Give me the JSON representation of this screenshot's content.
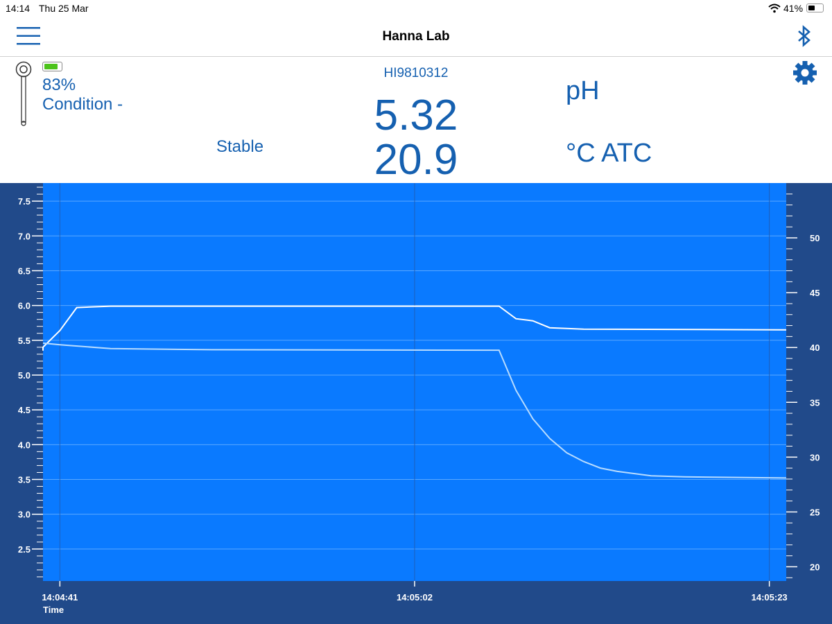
{
  "status_bar": {
    "time": "14:14",
    "date": "Thu 25 Mar",
    "battery": "41%",
    "battery_level": 0.41
  },
  "navbar": {
    "title": "Hanna Lab",
    "menu_icon": "hamburger-menu-icon",
    "bluetooth_icon": "bluetooth-icon"
  },
  "probe": {
    "battery_percent": "83%",
    "battery_level": 0.83,
    "battery_color": "#4cc31a",
    "condition": "Condition -",
    "icon": "probe-icon"
  },
  "reading": {
    "probe_id": "HI9810312",
    "primary_value": "5.32",
    "primary_unit": "pH",
    "secondary_value": "20.9",
    "secondary_unit": "°C ATC",
    "stability": "Stable",
    "settings_icon": "gear-icon"
  },
  "colors": {
    "accent": "#1560b0",
    "plot_bg": "#0a7aff",
    "axis_bg": "#214a8a"
  },
  "chart_data": {
    "type": "line",
    "xlabel": "Time",
    "x_ticks": [
      "14:04:41",
      "14:05:02",
      "14:05:23"
    ],
    "xlim": [
      "14:04:40",
      "14:05:24"
    ],
    "left_axis": {
      "ylim": [
        2.04,
        7.76
      ],
      "ticks": [
        2.5,
        3.0,
        3.5,
        4.0,
        4.5,
        5.0,
        5.5,
        6.0,
        6.5,
        7.0,
        7.5
      ]
    },
    "right_axis": {
      "ylim": [
        18.7,
        55
      ],
      "ticks": [
        20,
        25,
        30,
        35,
        40,
        45,
        50
      ]
    },
    "grid": true,
    "series": [
      {
        "axis": "left",
        "color": "#ffffff",
        "x": [
          "14:04:40",
          "14:04:40",
          "14:04:41",
          "14:04:42",
          "14:04:44",
          "14:05:07",
          "14:05:08",
          "14:05:09",
          "14:05:10",
          "14:05:12",
          "14:05:24"
        ],
        "y": [
          5.35,
          5.4,
          5.64,
          5.97,
          5.99,
          5.99,
          5.81,
          5.78,
          5.68,
          5.66,
          5.65
        ]
      },
      {
        "axis": "right",
        "color": "#b8dcff",
        "x": [
          "14:04:40",
          "14:04:41",
          "14:04:44",
          "14:04:50",
          "14:05:07",
          "14:05:08",
          "14:05:09",
          "14:05:10",
          "14:05:11",
          "14:05:12",
          "14:05:13",
          "14:05:14",
          "14:05:16",
          "14:05:18",
          "14:05:24"
        ],
        "y": [
          40.4,
          40.25,
          39.9,
          39.8,
          39.75,
          36.1,
          33.5,
          31.7,
          30.4,
          29.6,
          29.0,
          28.7,
          28.3,
          28.2,
          28.1
        ]
      }
    ]
  }
}
